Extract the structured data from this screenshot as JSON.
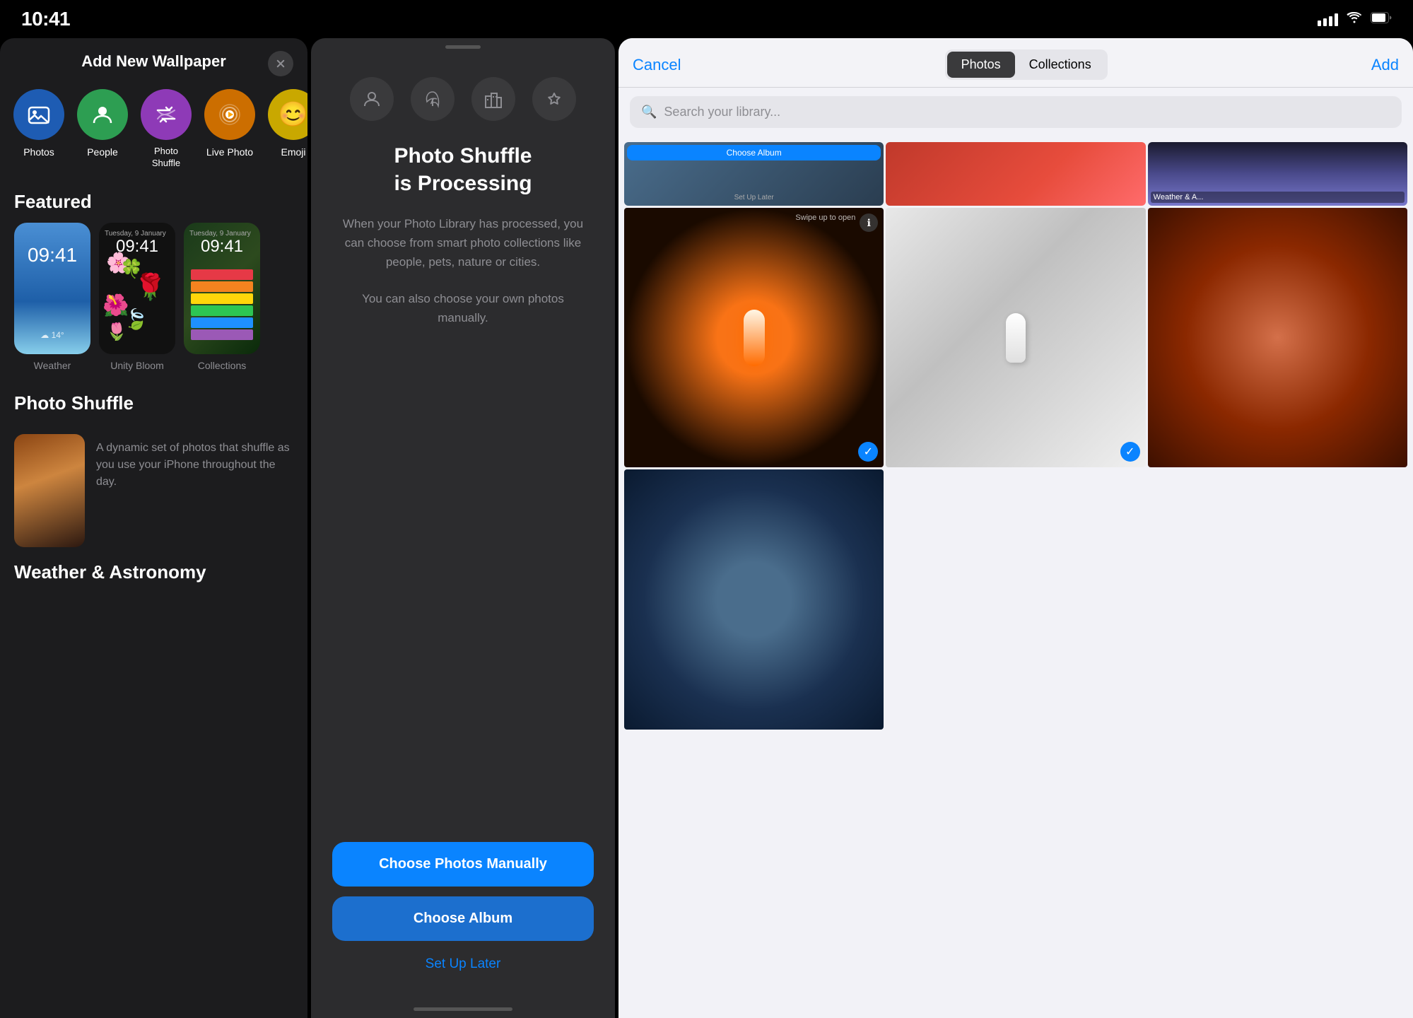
{
  "statusBar": {
    "time": "10:41",
    "signal": "●●●●",
    "wifi": "wifi",
    "battery": "battery"
  },
  "panel1": {
    "title": "Add New Wallpaper",
    "closeLabel": "×",
    "types": [
      {
        "id": "photos",
        "label": "Photos",
        "color": "#1e90ff",
        "icon": "🖼"
      },
      {
        "id": "people",
        "label": "People",
        "color": "#34c759",
        "icon": "👤"
      },
      {
        "id": "photo-shuffle",
        "label": "Photo\nShuffle",
        "color": "#af52de",
        "icon": "🔀"
      },
      {
        "id": "live-photo",
        "label": "Live Photo",
        "color": "#ff9500",
        "icon": "▶"
      },
      {
        "id": "emoji",
        "label": "Emoji",
        "color": "#ffd60a",
        "icon": "😊"
      }
    ],
    "featuredTitle": "Featured",
    "featured": [
      {
        "id": "weather",
        "label": "Weather",
        "time": "09:41"
      },
      {
        "id": "unity-bloom",
        "label": "Unity Bloom",
        "time": "09:41"
      },
      {
        "id": "collections",
        "label": "Collections",
        "time": "09:41"
      }
    ],
    "photoShuffleTitle": "Photo Shuffle",
    "shuffleDescription": "A dynamic set of photos that shuffle as you use your iPhone throughout the day.",
    "weatherAstronomy": "Weather & Astronomy"
  },
  "panel2": {
    "filterIcons": [
      "person",
      "leaf",
      "building",
      "star"
    ],
    "processingTitle": "Photo Shuffle\nis Processing",
    "processingDesc1": "When your Photo Library has processed, you can choose from smart photo collections like people, pets, nature or cities.",
    "processingDesc2": "You can also choose your own photos manually.",
    "chooseManuallyLabel": "Choose Photos Manually",
    "chooseAlbumLabel": "Choose Album",
    "setUpLaterLabel": "Set Up Later"
  },
  "panel3": {
    "cancelLabel": "Cancel",
    "tabs": [
      {
        "id": "photos",
        "label": "Photos",
        "active": true
      },
      {
        "id": "collections",
        "label": "Collections",
        "active": false
      }
    ],
    "addLabel": "Add",
    "searchPlaceholder": "Search your library...",
    "albumStrip": [
      {
        "id": "choose-album",
        "label": "Choose Album",
        "hasBluBtn": true,
        "btnText": "Choose Album",
        "setupText": "Set Up Later"
      },
      {
        "id": "red-photo",
        "label": ""
      },
      {
        "id": "weather-album",
        "label": "Weather & A..."
      }
    ],
    "photos": [
      {
        "id": "candle",
        "type": "orange-candle",
        "selected": true
      },
      {
        "id": "mouse",
        "type": "brown-mouse",
        "selected": true
      },
      {
        "id": "warm",
        "type": "warm-blur",
        "selected": false
      },
      {
        "id": "cool",
        "type": "cool-blur",
        "selected": false
      }
    ]
  }
}
